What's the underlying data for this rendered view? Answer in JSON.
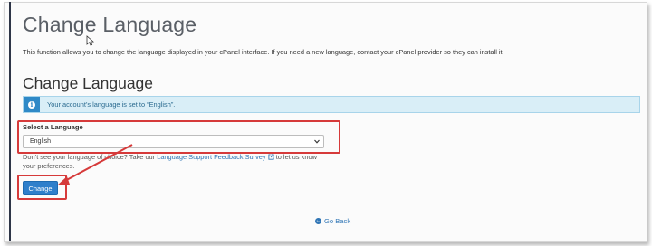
{
  "page": {
    "title": "Change Language",
    "intro": "This function allows you to change the language displayed in your cPanel interface. If you need a new language, contact your cPanel provider so they can install it."
  },
  "section": {
    "title": "Change Language",
    "alert_text": "Your account’s language is set to “English”.",
    "alert_icon": "info-icon"
  },
  "form": {
    "select_label": "Select a Language",
    "selected_language": "English",
    "help_prefix": "Don’t see your language of choice? Take our",
    "help_link": "Language Support Feedback Survey",
    "help_suffix": "to let us know your preferences.",
    "change_button": "Change"
  },
  "footer": {
    "go_back": "Go Back"
  },
  "colors": {
    "accent": "#2f7fcb",
    "annotation": "#d63a3a",
    "alert_bg": "#d9eef7"
  }
}
